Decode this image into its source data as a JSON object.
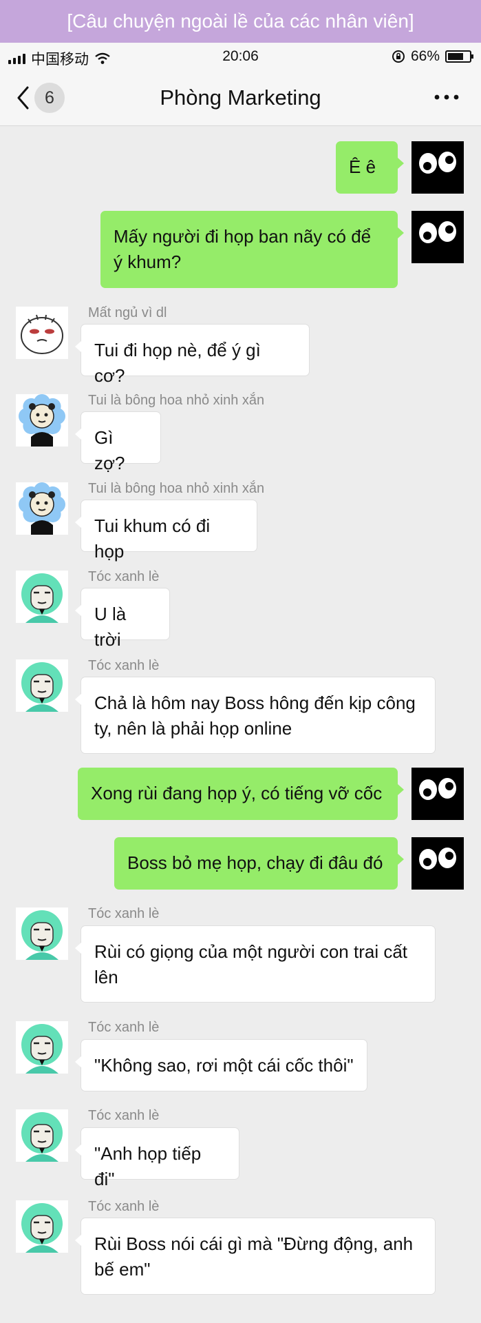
{
  "banner": "[Câu chuyện ngoài lề của các nhân viên]",
  "status_bar": {
    "carrier": "中国移动",
    "time": "20:06",
    "battery": "66%"
  },
  "nav": {
    "back_count": "6",
    "title": "Phòng Marketing"
  },
  "messages": [
    {
      "side": "out",
      "text": "Ê ê"
    },
    {
      "side": "out",
      "text": "Mấy người đi họp ban nãy có để ý khum?"
    },
    {
      "side": "in",
      "sender": "Mất ngủ vì dl",
      "avatar": "sleepy",
      "text": "Tui đi họp nè, để ý gì cơ?"
    },
    {
      "side": "in",
      "sender": "Tui là bông hoa nhỏ xinh xắn",
      "avatar": "flower",
      "text": "Gì zợ?"
    },
    {
      "side": "in",
      "sender": "Tui là bông hoa nhỏ xinh xắn",
      "avatar": "flower",
      "text": "Tui khum có đi họp"
    },
    {
      "side": "in",
      "sender": "Tóc xanh lè",
      "avatar": "green-hair",
      "text": "U là trời"
    },
    {
      "side": "in",
      "sender": "Tóc xanh lè",
      "avatar": "green-hair",
      "text": "Chả là hôm nay Boss hông đến kịp công ty, nên là phải họp online"
    },
    {
      "side": "out",
      "text": "Xong rùi đang họp ý, có tiếng vỡ cốc"
    },
    {
      "side": "out",
      "text": "Boss bỏ mẹ họp, chạy đi đâu đó"
    },
    {
      "side": "in",
      "sender": "Tóc xanh lè",
      "avatar": "green-hair",
      "text": "Rùi có giọng của một người con trai cất lên"
    },
    {
      "side": "in",
      "sender": "Tóc xanh lè",
      "avatar": "green-hair",
      "text": "\"Không sao, rơi một cái cốc thôi\""
    },
    {
      "side": "in",
      "sender": "Tóc xanh lè",
      "avatar": "green-hair",
      "text": "\"Anh họp tiếp đi\""
    },
    {
      "side": "in",
      "sender": "Tóc xanh lè",
      "avatar": "green-hair",
      "text": "Rùi Boss nói cái gì mà \"Đừng động, anh bế em\""
    }
  ],
  "colors": {
    "banner": "#c5a6db",
    "outgoing_bubble": "#95ec69",
    "incoming_bubble": "#ffffff",
    "background": "#ededed"
  },
  "icons": {
    "back": "chevron-left-icon",
    "more": "more-dots-icon",
    "wifi": "wifi-icon",
    "signal": "signal-bars-icon",
    "lock": "rotation-lock-icon",
    "battery": "battery-icon"
  }
}
